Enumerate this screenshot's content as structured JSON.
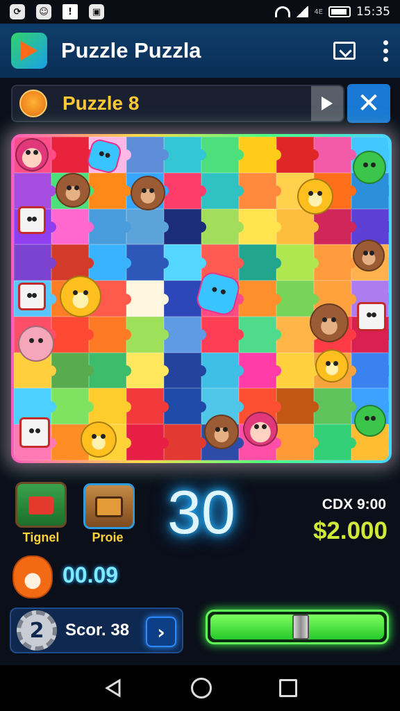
{
  "status_bar": {
    "icons": [
      "sync-icon",
      "avatar-status-icon",
      "alert-icon",
      "message-icon"
    ],
    "network_label": "4E",
    "time": "15:35"
  },
  "app_bar": {
    "title": "Puzzle Puzzla",
    "icons": [
      "app-logo-icon",
      "cast-icon",
      "more-vert-icon"
    ]
  },
  "level": {
    "title": "Puzzle 8",
    "avatar_icon": "lion-avatar-icon",
    "play_icon": "play-icon",
    "close_icon": "close-icon"
  },
  "board": {
    "columns": 10,
    "rows": 9,
    "tile_colors": [
      "#ff4d8a",
      "#e8233b",
      "#ffb8e6",
      "#5f8ed9",
      "#33c7d5",
      "#4ddf7c",
      "#ffcc1a",
      "#e02727",
      "#f35aa7",
      "#42c8ff",
      "#a64ddf",
      "#4ddf7c",
      "#ff8a1a",
      "#36a6ff",
      "#ff3d6b",
      "#30c2c2",
      "#ff8a3d",
      "#ffd14d",
      "#ff6f1a",
      "#2b8fda",
      "#8f3ef0",
      "#ff69cf",
      "#4a9ddc",
      "#5ca3d9",
      "#1b2c78",
      "#a2dd5c",
      "#ffe34f",
      "#ffbd3d",
      "#d1265a",
      "#5d3fd5",
      "#7b43cf",
      "#d43a2a",
      "#3ab3ff",
      "#2d57b9",
      "#53d6ff",
      "#ff5b53",
      "#21a68d",
      "#aee74f",
      "#ff9b3d",
      "#ffb14d",
      "#5ac5ff",
      "#ff7d26",
      "#ff5b4d",
      "#fff6e0",
      "#2e47b8",
      "#ff4b83",
      "#ff8f2a",
      "#77d458",
      "#ffa13d",
      "#ad7df0",
      "#ff4f68",
      "#ff4a33",
      "#ff7a24",
      "#9ee05a",
      "#5f9ae5",
      "#ff3d54",
      "#4fdb8c",
      "#ffb547",
      "#ff3b45",
      "#d92050",
      "#ffcf3d",
      "#58ac4d",
      "#3dbd6c",
      "#ffe75e",
      "#23439e",
      "#3fbfe5",
      "#ff3ca8",
      "#ffd13d",
      "#f6a43b",
      "#3b82f0",
      "#4bd0ff",
      "#7fe361",
      "#ffcc2e",
      "#f23a3a",
      "#1f4aa8",
      "#50c6e8",
      "#ff4f33",
      "#c25714",
      "#5fc35c",
      "#3ca2ff",
      "#ff79b4",
      "#ff8d26",
      "#ffd23a",
      "#e71f44",
      "#e23a33",
      "#2d4ba7",
      "#ff4fa6",
      "#ff9a39",
      "#33cf77",
      "#ffbe32"
    ],
    "characters": [
      {
        "name": "girl",
        "icon": "girl-icon"
      },
      {
        "name": "star-blue",
        "icon": "star-icon"
      },
      {
        "name": "frog",
        "icon": "frog-icon"
      },
      {
        "name": "bear",
        "icon": "bear-icon"
      },
      {
        "name": "bear-rainbow",
        "icon": "bear-icon"
      },
      {
        "name": "chick-rainbow",
        "icon": "chick-icon"
      },
      {
        "name": "block-cube",
        "icon": "cube-icon"
      },
      {
        "name": "bear-right",
        "icon": "bear-icon"
      },
      {
        "name": "cube-abc",
        "icon": "cube-icon"
      },
      {
        "name": "chick-flying",
        "icon": "chick-icon"
      },
      {
        "name": "star-center",
        "icon": "star-icon"
      },
      {
        "name": "bear-mid-right",
        "icon": "bear-icon"
      },
      {
        "name": "cube-right",
        "icon": "cube-icon"
      },
      {
        "name": "pink-bear",
        "icon": "bear-icon"
      },
      {
        "name": "chick-right",
        "icon": "chick-icon"
      },
      {
        "name": "toy-phone",
        "icon": "phone-icon"
      },
      {
        "name": "chick-bottom",
        "icon": "chick-icon"
      },
      {
        "name": "bear-bottom",
        "icon": "bear-icon"
      },
      {
        "name": "girl-bottom",
        "icon": "girl-icon"
      },
      {
        "name": "frog-bottom",
        "icon": "frog-icon"
      }
    ]
  },
  "tools": [
    {
      "label": "Tignel",
      "icon": "tractor-icon"
    },
    {
      "label": "Proie",
      "icon": "chest-icon"
    }
  ],
  "counter": "30",
  "currency_label": "CDX 9:00",
  "money": "$2.000",
  "timer": "00.09",
  "timer_avatar_icon": "fox-icon",
  "score": {
    "badge": "2",
    "label": "Scor. 38",
    "next_icon": "chevron-right-icon"
  },
  "progress": {
    "value": 0.52,
    "color": "#3cff48"
  },
  "nav": {
    "icons": [
      "back-icon",
      "home-icon",
      "recents-icon"
    ]
  }
}
